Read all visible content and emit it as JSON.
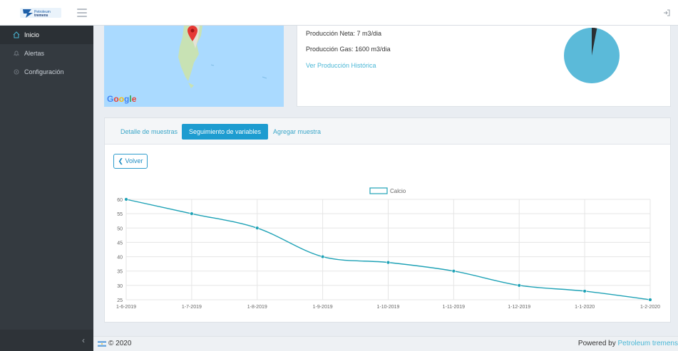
{
  "header": {
    "logo_text": "Petroleum tremens",
    "logo_icon": "petroleum-logo",
    "menu_icon": "hamburger-icon",
    "logout_icon": "logout-icon"
  },
  "sidebar": {
    "items": [
      {
        "label": "Inicio",
        "icon": "home-icon"
      },
      {
        "label": "Alertas",
        "icon": "bell-icon"
      },
      {
        "label": "Configuración",
        "icon": "gear-icon"
      }
    ],
    "collapse_icon": "chevron-left-icon"
  },
  "map": {
    "provider_label": "Google",
    "marker_icon": "map-marker-icon"
  },
  "info": {
    "produccion_neta": "Producción Neta: 7 m3/dia",
    "produccion_gas": "Producción Gas: 1600 m3/dia",
    "historic_link": "Ver Producción Histórica"
  },
  "pie": {
    "colors": {
      "main": "#5bbad9",
      "slice": "#2b2f33"
    },
    "slice_fraction": 0.03
  },
  "tabs": [
    {
      "label": "Detalle de muestras",
      "active": false
    },
    {
      "label": "Seguimiento de variables",
      "active": true
    },
    {
      "label": "Agregar muestra",
      "active": false
    }
  ],
  "back_button": "Volver",
  "chart_data": {
    "type": "line",
    "legend": "Calcio",
    "legend_placement": "top-center",
    "categories": [
      "1-6-2019",
      "1-7-2019",
      "1-8-2019",
      "1-9-2019",
      "1-10-2019",
      "1-11-2019",
      "1-12-2019",
      "1-1-2020",
      "1-2-2020"
    ],
    "series": [
      {
        "name": "Calcio",
        "values": [
          60,
          55,
          50,
          40,
          38,
          35,
          30,
          28,
          25
        ]
      }
    ],
    "yticks": [
      25,
      30,
      35,
      40,
      45,
      50,
      55,
      60
    ],
    "ylim": [
      25,
      60
    ],
    "grid": true,
    "color": "#1fa2b6"
  },
  "footer": {
    "copyright": "© 2020",
    "powered_prefix": "Powered by ",
    "powered_link": "Petroleum tremens",
    "flag_icon": "argentina-flag-icon"
  }
}
